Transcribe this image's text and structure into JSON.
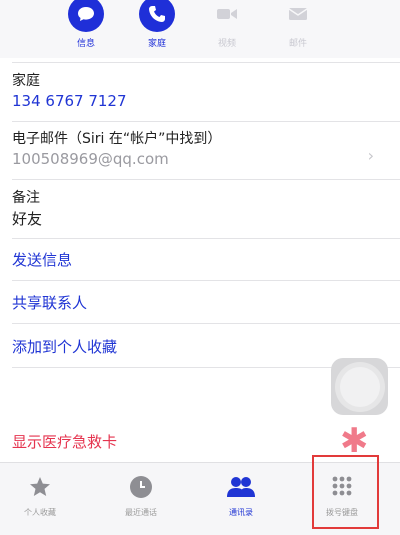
{
  "actions": [
    {
      "icon": "message-icon",
      "label": "信息",
      "enabled": true
    },
    {
      "icon": "phone-icon",
      "label": "家庭",
      "enabled": true
    },
    {
      "icon": "video-icon",
      "label": "视频",
      "enabled": false
    },
    {
      "icon": "mail-icon",
      "label": "邮件",
      "enabled": false
    }
  ],
  "phone": {
    "label": "家庭",
    "value": "134 6767 7127"
  },
  "email": {
    "label": "电子邮件（Siri 在“帐户”中找到）",
    "value": "100508969@qq.com"
  },
  "notes": {
    "label": "备注",
    "value": "好友"
  },
  "links": {
    "send_message": "发送信息",
    "share_contact": "共享联系人",
    "add_favorite": "添加到个人收藏",
    "medical_id": "显示医疗急救卡"
  },
  "tabs": [
    {
      "icon": "star-icon",
      "label": "个人收藏",
      "active": false
    },
    {
      "icon": "clock-icon",
      "label": "最近通话",
      "active": false
    },
    {
      "icon": "contacts-icon",
      "label": "通讯录",
      "active": true
    },
    {
      "icon": "keypad-icon",
      "label": "拨号键盘",
      "active": false
    }
  ],
  "colors": {
    "accent": "#2035d4",
    "destructive": "#e5344f",
    "highlight": "#e23a3a"
  }
}
